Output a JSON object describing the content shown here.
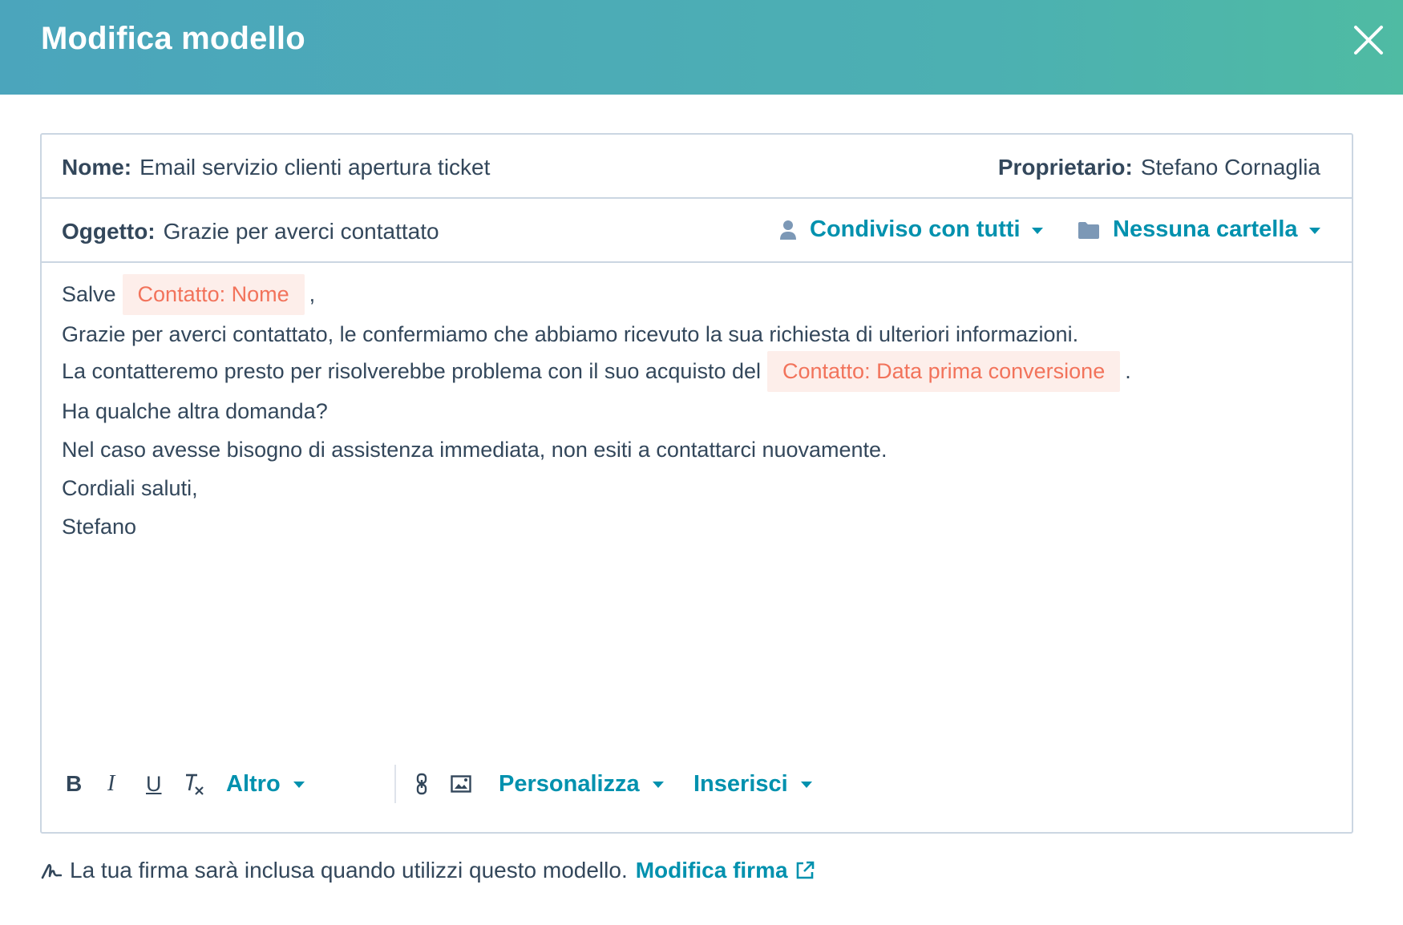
{
  "header": {
    "title": "Modifica modello"
  },
  "meta": {
    "name_label": "Nome:",
    "name_value": "Email servizio clienti apertura ticket",
    "owner_label": "Proprietario:",
    "owner_value": "Stefano Cornaglia",
    "subject_label": "Oggetto:",
    "subject_value": "Grazie per averci contattato",
    "sharing": "Condiviso con tutti",
    "folder": "Nessuna cartella"
  },
  "body": {
    "greeting": "Salve",
    "token_name": "Contatto: Nome",
    "greeting_end": ",",
    "line2": "Grazie per averci contattato, le confermiamo che abbiamo ricevuto la sua richiesta di ulteriori informazioni.",
    "line3": "La contatteremo presto per risolverebbe problema con il suo acquisto del",
    "token_date": "Contatto: Data prima conversione",
    "line3_end": ".",
    "line4": "Ha qualche altra domanda?",
    "line5": "Nel caso avesse bisogno di assistenza immediata, non esiti a contattarci nuovamente.",
    "line6": "Cordiali saluti,",
    "line7": "Stefano"
  },
  "toolbar": {
    "bold": "B",
    "italic": "I",
    "underline": "U",
    "more": "Altro",
    "personalize": "Personalizza",
    "insert": "Inserisci"
  },
  "footer": {
    "text": "La tua firma sarà inclusa quando utilizzi questo modello.",
    "link": "Modifica firma"
  },
  "colors": {
    "accent": "#0091ae",
    "token_text": "#f2735b",
    "token_bg": "#fdeeea",
    "header_start": "#4ba5bc",
    "header_end": "#4fbba3"
  }
}
